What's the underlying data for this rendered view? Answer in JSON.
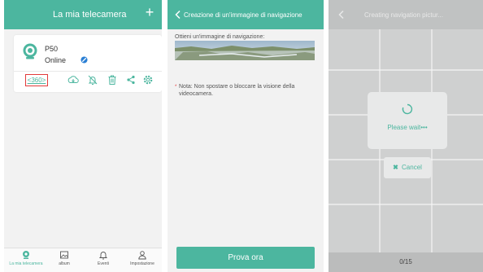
{
  "panel1": {
    "title": "La mia telecamera",
    "plus_icon": "+",
    "camera": {
      "name": "P50",
      "status": "Online"
    },
    "tool_360": "<360>",
    "nav": [
      {
        "label": "La mia telecamera",
        "active": true
      },
      {
        "label": "album",
        "active": false
      },
      {
        "label": "Eventi",
        "active": false
      },
      {
        "label": "Impostazione",
        "active": false
      }
    ]
  },
  "panel2": {
    "title": "Creazione di un'immagine di navigazione",
    "label": "Ottieni un'immagine di navigazione:",
    "note_star": "*",
    "note": "Nota: Non spostare o bloccare la visione della videocamera.",
    "button": "Prova ora"
  },
  "panel3": {
    "title": "Creating navigation pictur...",
    "wait": "Please wait•••",
    "cancel_x": "✖",
    "cancel": "Cancel",
    "progress": "0/15"
  },
  "colors": {
    "accent": "#4cb69f",
    "highlight": "#e23b3b"
  }
}
